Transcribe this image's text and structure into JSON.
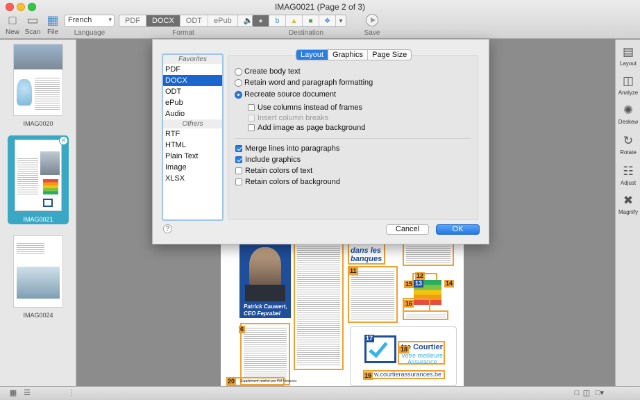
{
  "window": {
    "title": "IMAG0021 (Page 2 of 3)"
  },
  "toolbar": {
    "new_label": "New",
    "scan_label": "Scan",
    "file_label": "File",
    "language_value": "French",
    "language_group": "Language",
    "formats": [
      "PDF",
      "DOCX",
      "ODT",
      "ePub"
    ],
    "active_format": "DOCX",
    "format_group": "Format",
    "destination_group": "Destination",
    "save_label": "Save",
    "icons": {
      "new": "new-document-icon",
      "scan": "scanner-icon",
      "file": "folder-icon",
      "audio": "speaker-icon"
    }
  },
  "sidebar": {
    "pages": [
      {
        "label": "IMAG0020",
        "selected": false
      },
      {
        "label": "IMAG0021",
        "selected": true
      },
      {
        "label": "IMAG0024",
        "selected": false
      }
    ]
  },
  "right_panel": {
    "items": [
      "Layout",
      "Analyze",
      "Deskew",
      "Rotate",
      "Adjust",
      "Magnify"
    ]
  },
  "dialog": {
    "favorites_header": "Favorites",
    "favorites": [
      "PDF",
      "DOCX",
      "ODT",
      "ePub",
      "Audio"
    ],
    "selected_format": "DOCX",
    "others_header": "Others",
    "others": [
      "RTF",
      "HTML",
      "Plain Text",
      "Image",
      "XLSX"
    ],
    "tabs": [
      "Layout",
      "Graphics",
      "Page Size"
    ],
    "active_tab": "Layout",
    "layout_options": [
      {
        "label": "Create body text",
        "checked": false
      },
      {
        "label": "Retain word and paragraph formatting",
        "checked": false
      },
      {
        "label": "Recreate source document",
        "checked": true
      }
    ],
    "sub_options": [
      {
        "label": "Use columns instead of frames",
        "checked": false,
        "enabled": true
      },
      {
        "label": "Insert column breaks",
        "checked": false,
        "enabled": false
      },
      {
        "label": "Add image as page background",
        "checked": false,
        "enabled": true
      }
    ],
    "text_options": [
      {
        "label": "Merge lines into paragraphs",
        "checked": true
      },
      {
        "label": "Include graphics",
        "checked": true
      },
      {
        "label": "Retain colors of text",
        "checked": false
      },
      {
        "label": "Retain colors of background",
        "checked": false
      }
    ],
    "help_label": "?",
    "cancel_label": "Cancel",
    "ok_label": "OK"
  },
  "document": {
    "photo_caption_name": "Patrick Cauwert,",
    "photo_caption_title": "CEO Feprabel",
    "heading_fragment_1": "dans les",
    "heading_fragment_2": "banques",
    "logo_heading": "tre Courtier",
    "logo_subline_1": "Votre meilleure",
    "logo_subline_2": "Assurance",
    "footer_url": "w.courtierassurances.be",
    "page_footer": "Supplément réalisé par PM Ventures",
    "page_number": "20",
    "region_numbers": [
      "6",
      "11",
      "12",
      "13",
      "14",
      "15",
      "16",
      "17",
      "18",
      "19",
      "20"
    ],
    "colors": {
      "region_border": "#f0a030",
      "photo_background": "#1f4e9b",
      "logo_blue": "#1f4e9b"
    }
  }
}
